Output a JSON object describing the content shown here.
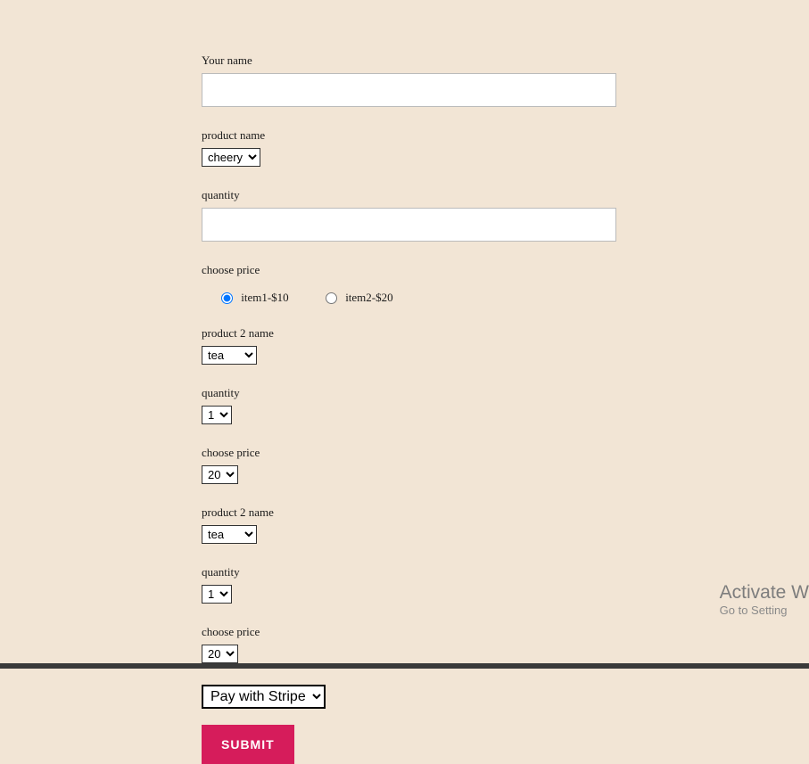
{
  "labels": {
    "yourName": "Your name",
    "productName": "product name",
    "quantity": "quantity",
    "choosePrice": "choose price",
    "product2Name": "product 2 name"
  },
  "selects": {
    "product1": "cheery",
    "product2a": "tea",
    "qty2a": "1",
    "price2a": "20",
    "product2b": "tea",
    "qty2b": "1",
    "price2b": "20",
    "payment": "Pay with Stripe"
  },
  "radios": {
    "item1": "item1-$10",
    "item2": "item2-$20"
  },
  "submit": "SUBMIT",
  "watermark": {
    "title": "Activate W",
    "sub": "Go to Setting"
  }
}
